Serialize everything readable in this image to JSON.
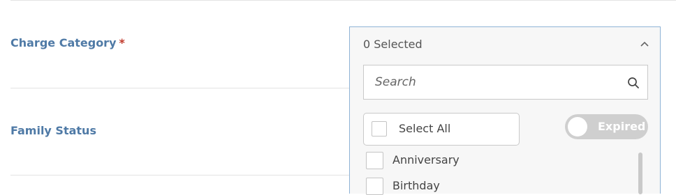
{
  "fields": {
    "charge_category": {
      "label": "Charge Category",
      "required_mark": "*"
    },
    "family_status": {
      "label": "Family Status"
    }
  },
  "dropdown": {
    "selected_text": "0 Selected",
    "search": {
      "placeholder": "Search",
      "value": ""
    },
    "select_all_label": "Select All",
    "expired_toggle": {
      "label": "Expired",
      "on": false
    },
    "options": [
      {
        "label": "Anniversary",
        "checked": false
      },
      {
        "label": "Birthday",
        "checked": false
      }
    ]
  },
  "colors": {
    "label_blue": "#4f7aa6",
    "required_red": "#c0392b",
    "dropdown_border": "#8fb3d6",
    "toggle_off": "#cfcfcf"
  },
  "icons": {
    "chevron": "chevron-up-icon",
    "search": "search-icon"
  }
}
